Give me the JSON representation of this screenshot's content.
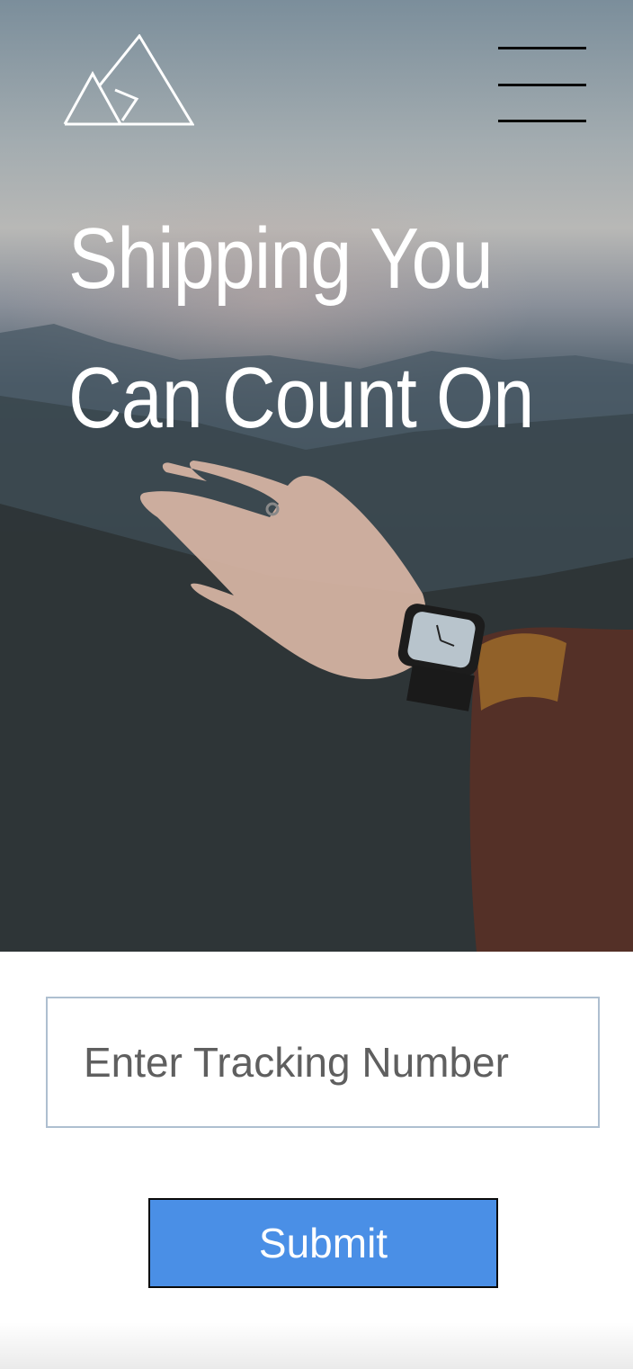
{
  "hero": {
    "background_image": "hand-with-watch-over-mountains",
    "title_line1": "Shipping You",
    "title_line2": "Can Count On"
  },
  "header": {
    "logo_icon": "mountain-triangles-logo",
    "menu_icon": "hamburger-menu-icon"
  },
  "tracking": {
    "placeholder": "Enter Tracking Number",
    "value": ""
  },
  "submit": {
    "label": "Submit"
  },
  "colors": {
    "submit_bg": "#4a8fe6",
    "input_border": "#aebfd0",
    "title": "#ffffff"
  }
}
